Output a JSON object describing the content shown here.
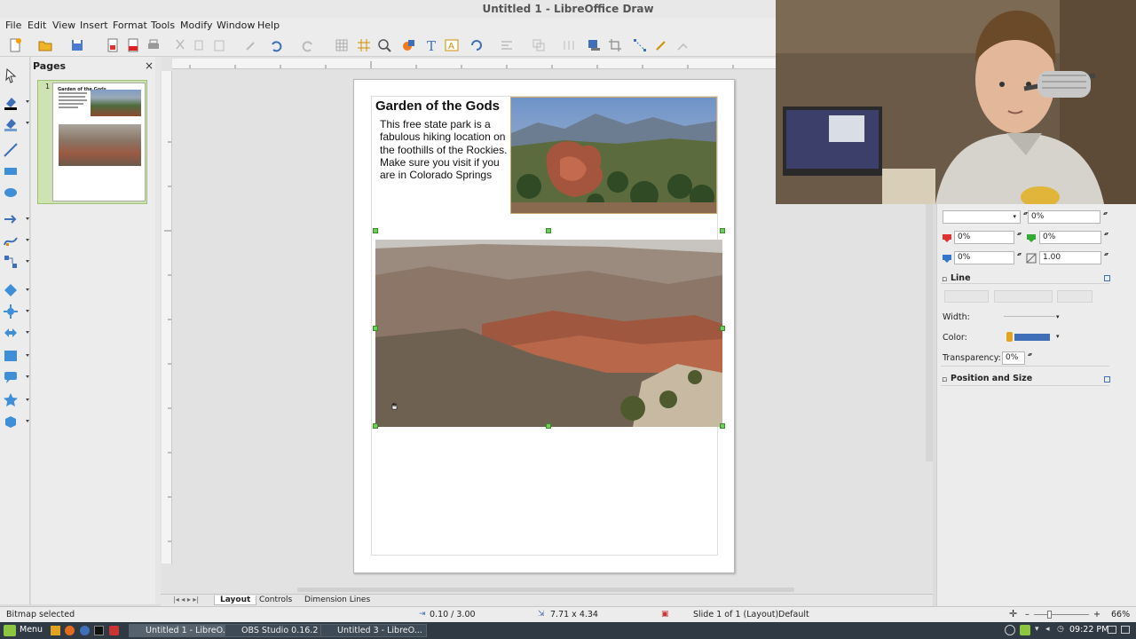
{
  "window": {
    "title": "Untitled 1 - LibreOffice Draw"
  },
  "menubar": [
    "File",
    "Edit",
    "View",
    "Insert",
    "Format",
    "Tools",
    "Modify",
    "Window",
    "Help"
  ],
  "pages_panel": {
    "title": "Pages",
    "close": "×",
    "page_number": "1"
  },
  "document": {
    "heading": "Garden of the Gods",
    "body": "This free state park is a fabulous hiking location on the foothills of the Rockies.  Make sure you visit if you are in Colorado Springs"
  },
  "tabs": [
    "Layout",
    "Controls",
    "Dimension Lines"
  ],
  "statusbar": {
    "selection": "Bitmap selected",
    "position": "0.10 / 3.00",
    "size": "7.71 x 4.34",
    "slide": "Slide 1 of 1 (Layout)",
    "master": "Default",
    "zoom": "66%"
  },
  "properties": {
    "transparency_top": "0%",
    "gradient_start": "0%",
    "gradient_end": "0%",
    "angle": "0%",
    "border": "1.00",
    "line_section": "Line",
    "width_label": "Width:",
    "color_label": "Color:",
    "line_color": "#3f6fb8",
    "transparency_label": "Transparency:",
    "transparency_value": "0%",
    "position_size_section": "Position and Size"
  },
  "taskbar": {
    "menu": "Menu",
    "tasks": [
      "Untitled 1 - LibreO...",
      "OBS Studio 0.16.2 (...",
      "Untitled 3 - LibreO..."
    ],
    "clock": "09:22 PM"
  }
}
